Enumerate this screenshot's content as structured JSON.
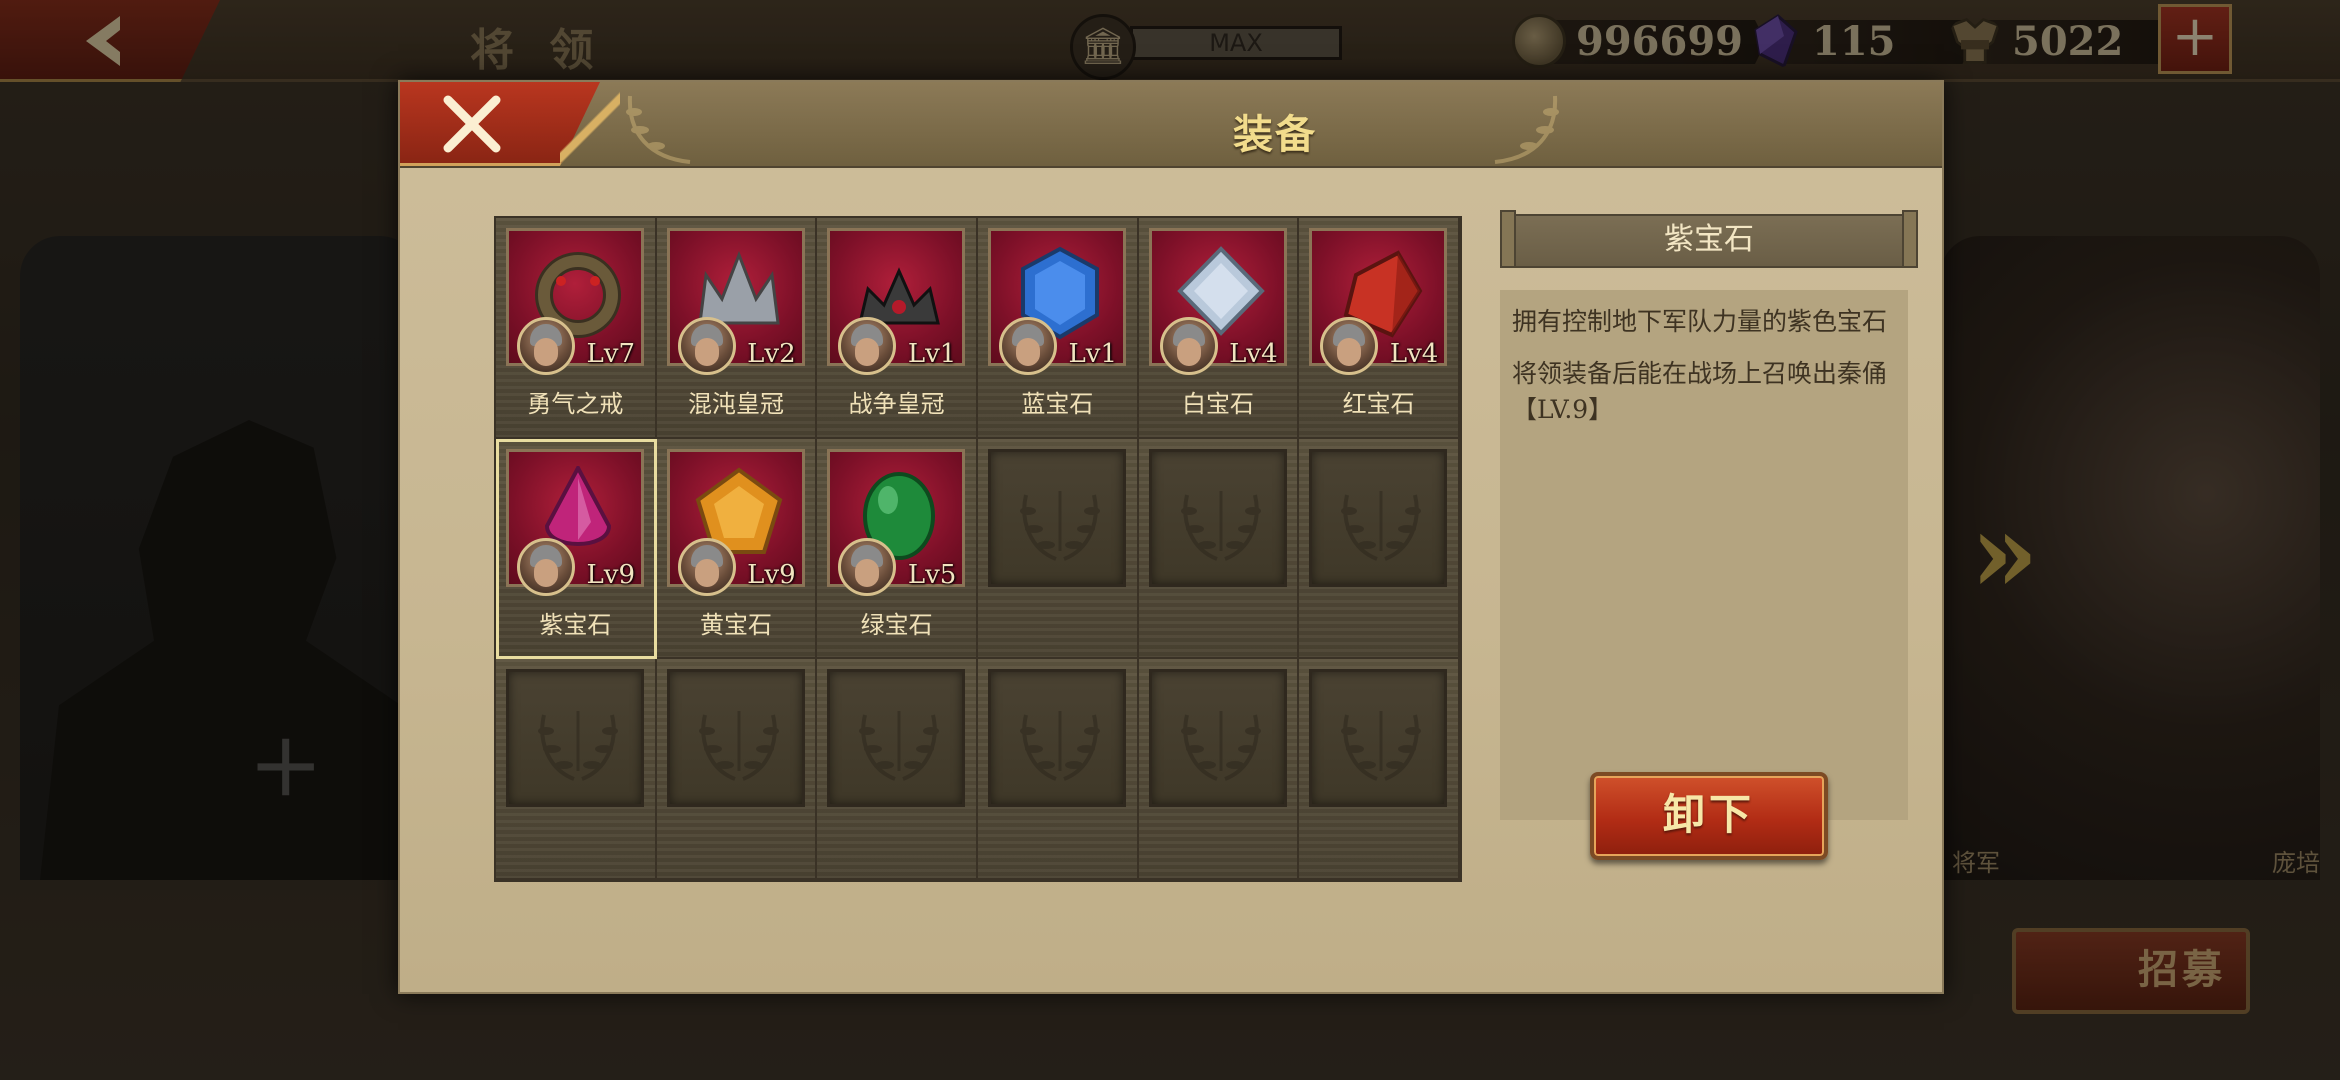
{
  "header": {
    "title": "将 领",
    "level_label": "MAX",
    "currencies": [
      {
        "icon": "coin-icon",
        "value": "996699",
        "color": "#8e7b56"
      },
      {
        "icon": "purple-gem-icon",
        "value": "115",
        "color": "#5a3c8c"
      },
      {
        "icon": "spqr-eagle-icon",
        "value": "5022",
        "color": "#8e7b56"
      }
    ]
  },
  "background": {
    "rank_left": "将军",
    "rank_right": "庞培",
    "recruit_label": "招募"
  },
  "modal": {
    "title": "装备",
    "items": [
      {
        "name": "勇气之戒",
        "level": "Lv7",
        "gem": "ring",
        "color": "#6a5a3a"
      },
      {
        "name": "混沌皇冠",
        "level": "Lv2",
        "gem": "crown-silver",
        "color": "#9aa0a8"
      },
      {
        "name": "战争皇冠",
        "level": "Lv1",
        "gem": "crown-dark",
        "color": "#3a3a3a"
      },
      {
        "name": "蓝宝石",
        "level": "Lv1",
        "gem": "hexagon",
        "color": "#2d6fd0"
      },
      {
        "name": "白宝石",
        "level": "Lv4",
        "gem": "diamond",
        "color": "#b9c9db"
      },
      {
        "name": "红宝石",
        "level": "Lv4",
        "gem": "shard",
        "color": "#c83224"
      },
      {
        "name": "紫宝石",
        "level": "Lv9",
        "gem": "teardrop",
        "color": "#c0247a"
      },
      {
        "name": "黄宝石",
        "level": "Lv9",
        "gem": "pentagon",
        "color": "#e0901e"
      },
      {
        "name": "绿宝石",
        "level": "Lv5",
        "gem": "egg",
        "color": "#1e8a3a"
      }
    ],
    "selected_index": 6,
    "empty_slots": 9,
    "detail": {
      "name": "紫宝石",
      "desc1": "拥有控制地下军队力量的紫色宝石",
      "desc2": "将领装备后能在战场上召唤出秦俑【LV.9】"
    },
    "unequip_label": "卸下"
  }
}
